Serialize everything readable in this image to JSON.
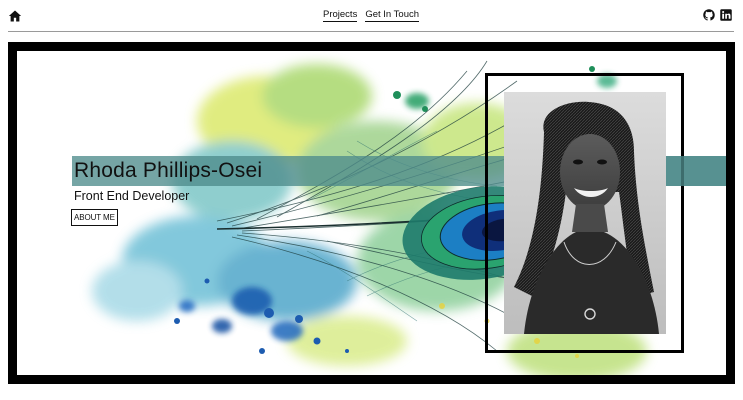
{
  "nav": {
    "home_icon": "home-icon",
    "links": [
      {
        "label": "Projects"
      },
      {
        "label": "Get In Touch"
      }
    ],
    "social": [
      {
        "icon": "github-icon"
      },
      {
        "icon": "linkedin-icon"
      }
    ]
  },
  "hero": {
    "name": "Rhoda Phillips-Osei",
    "role": "Front End Developer",
    "about_button": "ABOUT ME",
    "band_color": "#4e8c8c",
    "frame_color": "#000000"
  }
}
